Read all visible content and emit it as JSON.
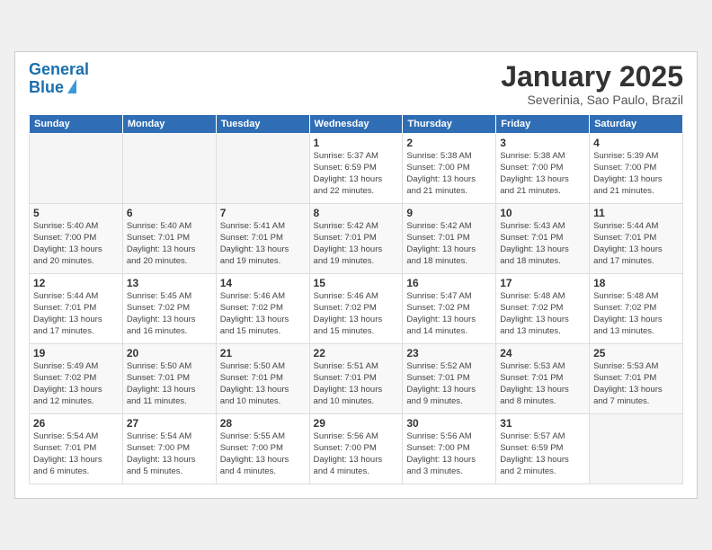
{
  "header": {
    "logo_line1": "General",
    "logo_line2": "Blue",
    "month_title": "January 2025",
    "location": "Severinia, Sao Paulo, Brazil"
  },
  "weekdays": [
    "Sunday",
    "Monday",
    "Tuesday",
    "Wednesday",
    "Thursday",
    "Friday",
    "Saturday"
  ],
  "weeks": [
    [
      {
        "day": "",
        "info": ""
      },
      {
        "day": "",
        "info": ""
      },
      {
        "day": "",
        "info": ""
      },
      {
        "day": "1",
        "info": "Sunrise: 5:37 AM\nSunset: 6:59 PM\nDaylight: 13 hours\nand 22 minutes."
      },
      {
        "day": "2",
        "info": "Sunrise: 5:38 AM\nSunset: 7:00 PM\nDaylight: 13 hours\nand 21 minutes."
      },
      {
        "day": "3",
        "info": "Sunrise: 5:38 AM\nSunset: 7:00 PM\nDaylight: 13 hours\nand 21 minutes."
      },
      {
        "day": "4",
        "info": "Sunrise: 5:39 AM\nSunset: 7:00 PM\nDaylight: 13 hours\nand 21 minutes."
      }
    ],
    [
      {
        "day": "5",
        "info": "Sunrise: 5:40 AM\nSunset: 7:00 PM\nDaylight: 13 hours\nand 20 minutes."
      },
      {
        "day": "6",
        "info": "Sunrise: 5:40 AM\nSunset: 7:01 PM\nDaylight: 13 hours\nand 20 minutes."
      },
      {
        "day": "7",
        "info": "Sunrise: 5:41 AM\nSunset: 7:01 PM\nDaylight: 13 hours\nand 19 minutes."
      },
      {
        "day": "8",
        "info": "Sunrise: 5:42 AM\nSunset: 7:01 PM\nDaylight: 13 hours\nand 19 minutes."
      },
      {
        "day": "9",
        "info": "Sunrise: 5:42 AM\nSunset: 7:01 PM\nDaylight: 13 hours\nand 18 minutes."
      },
      {
        "day": "10",
        "info": "Sunrise: 5:43 AM\nSunset: 7:01 PM\nDaylight: 13 hours\nand 18 minutes."
      },
      {
        "day": "11",
        "info": "Sunrise: 5:44 AM\nSunset: 7:01 PM\nDaylight: 13 hours\nand 17 minutes."
      }
    ],
    [
      {
        "day": "12",
        "info": "Sunrise: 5:44 AM\nSunset: 7:01 PM\nDaylight: 13 hours\nand 17 minutes."
      },
      {
        "day": "13",
        "info": "Sunrise: 5:45 AM\nSunset: 7:02 PM\nDaylight: 13 hours\nand 16 minutes."
      },
      {
        "day": "14",
        "info": "Sunrise: 5:46 AM\nSunset: 7:02 PM\nDaylight: 13 hours\nand 15 minutes."
      },
      {
        "day": "15",
        "info": "Sunrise: 5:46 AM\nSunset: 7:02 PM\nDaylight: 13 hours\nand 15 minutes."
      },
      {
        "day": "16",
        "info": "Sunrise: 5:47 AM\nSunset: 7:02 PM\nDaylight: 13 hours\nand 14 minutes."
      },
      {
        "day": "17",
        "info": "Sunrise: 5:48 AM\nSunset: 7:02 PM\nDaylight: 13 hours\nand 13 minutes."
      },
      {
        "day": "18",
        "info": "Sunrise: 5:48 AM\nSunset: 7:02 PM\nDaylight: 13 hours\nand 13 minutes."
      }
    ],
    [
      {
        "day": "19",
        "info": "Sunrise: 5:49 AM\nSunset: 7:02 PM\nDaylight: 13 hours\nand 12 minutes."
      },
      {
        "day": "20",
        "info": "Sunrise: 5:50 AM\nSunset: 7:01 PM\nDaylight: 13 hours\nand 11 minutes."
      },
      {
        "day": "21",
        "info": "Sunrise: 5:50 AM\nSunset: 7:01 PM\nDaylight: 13 hours\nand 10 minutes."
      },
      {
        "day": "22",
        "info": "Sunrise: 5:51 AM\nSunset: 7:01 PM\nDaylight: 13 hours\nand 10 minutes."
      },
      {
        "day": "23",
        "info": "Sunrise: 5:52 AM\nSunset: 7:01 PM\nDaylight: 13 hours\nand 9 minutes."
      },
      {
        "day": "24",
        "info": "Sunrise: 5:53 AM\nSunset: 7:01 PM\nDaylight: 13 hours\nand 8 minutes."
      },
      {
        "day": "25",
        "info": "Sunrise: 5:53 AM\nSunset: 7:01 PM\nDaylight: 13 hours\nand 7 minutes."
      }
    ],
    [
      {
        "day": "26",
        "info": "Sunrise: 5:54 AM\nSunset: 7:01 PM\nDaylight: 13 hours\nand 6 minutes."
      },
      {
        "day": "27",
        "info": "Sunrise: 5:54 AM\nSunset: 7:00 PM\nDaylight: 13 hours\nand 5 minutes."
      },
      {
        "day": "28",
        "info": "Sunrise: 5:55 AM\nSunset: 7:00 PM\nDaylight: 13 hours\nand 4 minutes."
      },
      {
        "day": "29",
        "info": "Sunrise: 5:56 AM\nSunset: 7:00 PM\nDaylight: 13 hours\nand 4 minutes."
      },
      {
        "day": "30",
        "info": "Sunrise: 5:56 AM\nSunset: 7:00 PM\nDaylight: 13 hours\nand 3 minutes."
      },
      {
        "day": "31",
        "info": "Sunrise: 5:57 AM\nSunset: 6:59 PM\nDaylight: 13 hours\nand 2 minutes."
      },
      {
        "day": "",
        "info": ""
      }
    ]
  ]
}
